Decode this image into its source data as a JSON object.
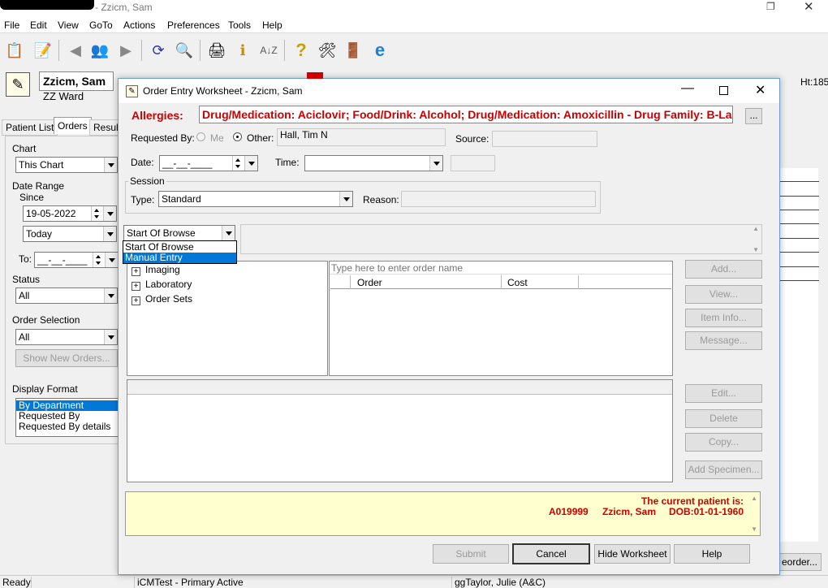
{
  "main_window": {
    "title": "- Zzicm, Sam",
    "menu": [
      "File",
      "Edit",
      "View",
      "GoTo",
      "Actions",
      "Preferences",
      "Tools",
      "Help"
    ],
    "patient_name": "Zzicm, Sam",
    "ward": "ZZ Ward",
    "ht_fragment": "Ht:185",
    "tabs": [
      "Patient List",
      "Orders",
      "Results"
    ],
    "chart_group": {
      "title": "Chart",
      "value": "This Chart"
    },
    "date_range": {
      "title": "Date Range",
      "since_label": "Since",
      "since_value": "19-05-2022",
      "today_value": "Today",
      "to_label": "To:",
      "to_value": "__-__-____"
    },
    "status": {
      "title": "Status",
      "value": "All"
    },
    "order_selection": {
      "title": "Order Selection",
      "value": "All",
      "show_new_orders": "Show New Orders..."
    },
    "display_format": {
      "title": "Display Format",
      "options": [
        "By Department",
        "Requested By",
        "Requested By details"
      ]
    },
    "reorder_fragment": "eorder...",
    "status_bar": {
      "ready": "Ready",
      "system": "iCMTest - Primary Active",
      "user": "ggTaylor, Julie  (A&C)"
    }
  },
  "dialog": {
    "title": "Order Entry Worksheet - Zzicm, Sam",
    "allergies_label": "Allergies:",
    "allergies_text": "Drug/Medication: Aciclovir; Food/Drink: Alcohol; Drug/Medication: Amoxicillin - Drug Family: B-Lact...",
    "ellipsis_button": "...",
    "requested_by_label": "Requested By:",
    "me_label": "Me",
    "other_label": "Other:",
    "other_value": "Hall, Tim N",
    "source_label": "Source:",
    "date_label": "Date:",
    "date_value": "__-__-____",
    "time_label": "Time:",
    "session": {
      "title": "Session",
      "type_label": "Type:",
      "type_value": "Standard",
      "reason_label": "Reason:"
    },
    "browse_select": "Start Of Browse",
    "browse_options": [
      "Start Of Browse",
      "Manual Entry"
    ],
    "tree_items": [
      "Imaging",
      "Laboratory",
      "Order Sets"
    ],
    "order_name_placeholder": "Type here to enter order name",
    "columns": [
      "Order",
      "Cost"
    ],
    "buttons": {
      "add": "Add...",
      "view": "View...",
      "item_info": "Item Info...",
      "message": "Message...",
      "edit": "Edit...",
      "delete": "Delete",
      "copy": "Copy...",
      "add_specimen": "Add Specimen...",
      "submit": "Submit",
      "cancel": "Cancel",
      "hide_worksheet": "Hide Worksheet",
      "help": "Help"
    },
    "patient_info": {
      "line1": "The current patient is:",
      "id": "A019999",
      "name": "Zzicm, Sam",
      "dob": "DOB:01-01-1960"
    }
  },
  "colors": {
    "allergy_red": "#cc0000",
    "selection_blue": "#0078d7",
    "info_yellow": "#ffffd0"
  }
}
